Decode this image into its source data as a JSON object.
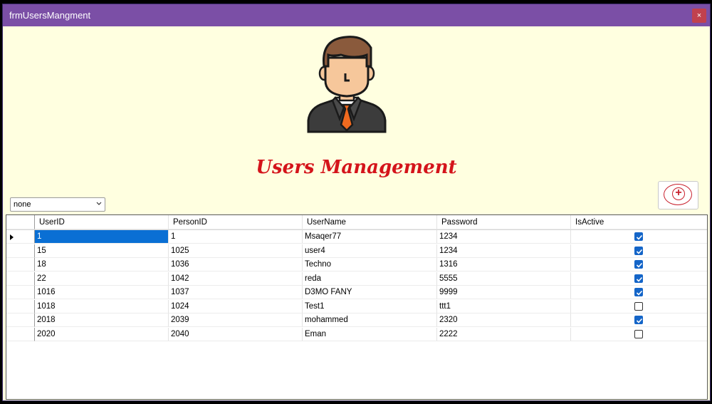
{
  "window": {
    "title": "frmUsersMangment",
    "close_label": "×"
  },
  "heading": "Users Management",
  "filter": {
    "selected": "none"
  },
  "add_button": {
    "icon": "add-circle-icon",
    "color": "#c8202c"
  },
  "grid": {
    "columns": [
      "UserID",
      "PersonID",
      "UserName",
      "Password",
      "IsActive"
    ],
    "rows": [
      {
        "UserID": "1",
        "PersonID": "1",
        "UserName": "Msaqer77",
        "Password": "1234",
        "IsActive": true
      },
      {
        "UserID": "15",
        "PersonID": "1025",
        "UserName": "user4",
        "Password": "1234",
        "IsActive": true
      },
      {
        "UserID": "18",
        "PersonID": "1036",
        "UserName": "Techno",
        "Password": "1316",
        "IsActive": true
      },
      {
        "UserID": "22",
        "PersonID": "1042",
        "UserName": "reda",
        "Password": "5555",
        "IsActive": true
      },
      {
        "UserID": "1016",
        "PersonID": "1037",
        "UserName": "D3MO FANY",
        "Password": "9999",
        "IsActive": true
      },
      {
        "UserID": "1018",
        "PersonID": "1024",
        "UserName": "Test1",
        "Password": "ttt1",
        "IsActive": false
      },
      {
        "UserID": "2018",
        "PersonID": "2039",
        "UserName": "mohammed",
        "Password": "2320",
        "IsActive": true
      },
      {
        "UserID": "2020",
        "PersonID": "2040",
        "UserName": "Eman",
        "Password": "2222",
        "IsActive": false
      }
    ],
    "selected_row": 0
  },
  "colors": {
    "titlebar": "#7b4fa6",
    "background": "#ffffe0",
    "heading": "#d4141b",
    "selection": "#0a6fd4",
    "checkbox": "#1465c8"
  }
}
